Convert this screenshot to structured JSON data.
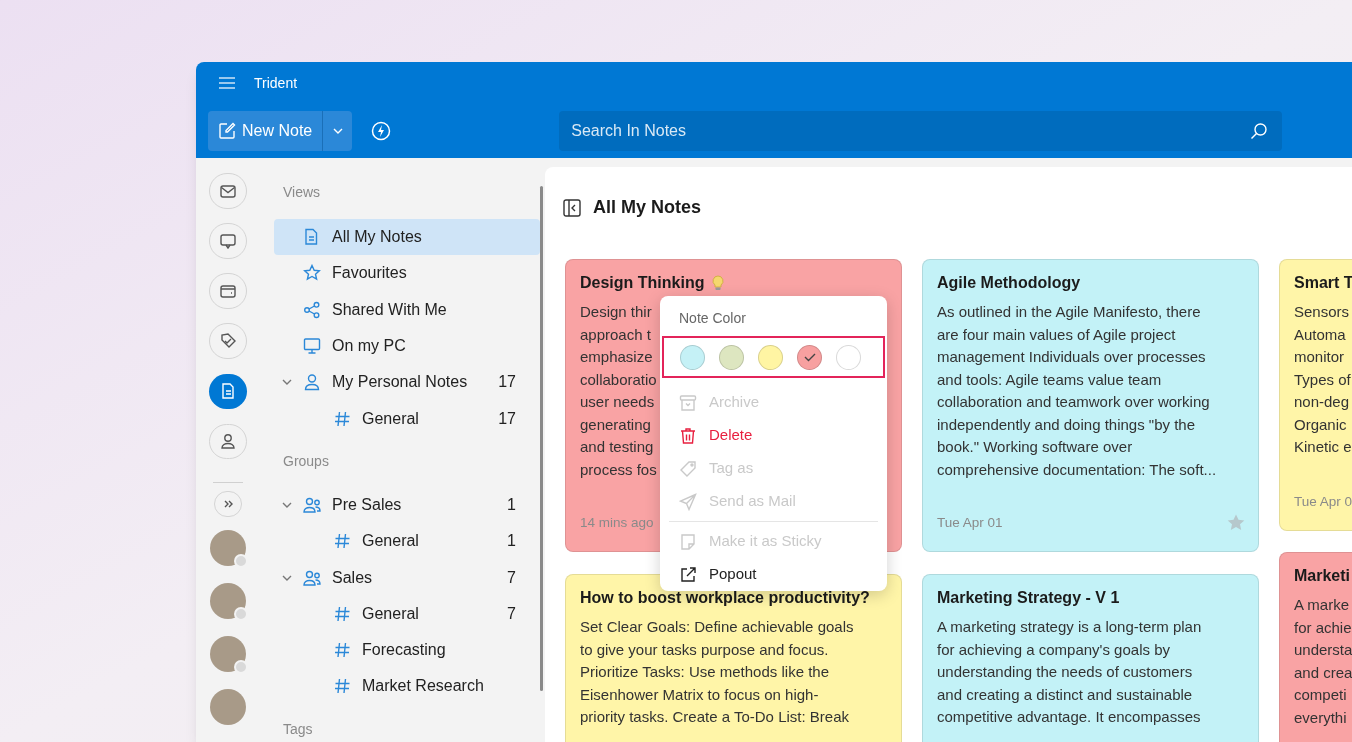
{
  "app": {
    "title": "Trident"
  },
  "toolbar": {
    "new_note": "New Note",
    "search": {
      "placeholder": "Search In Notes"
    }
  },
  "rail": {
    "items": [
      {
        "kind": "mail",
        "selected": false
      },
      {
        "kind": "chat",
        "selected": false
      },
      {
        "kind": "wallet",
        "selected": false
      },
      {
        "kind": "tags",
        "selected": false
      },
      {
        "kind": "notes",
        "selected": true
      },
      {
        "kind": "person",
        "selected": false
      }
    ]
  },
  "nav": {
    "sections": [
      {
        "title": "Views",
        "items": [
          {
            "label": "All My Notes",
            "kind": "note",
            "selected": true
          },
          {
            "label": "Favourites",
            "kind": "star",
            "selected": false
          },
          {
            "label": "Shared With Me",
            "kind": "share",
            "selected": false
          },
          {
            "label": "On my PC",
            "kind": "monitor",
            "selected": false
          },
          {
            "label": "My Personal Notes",
            "kind": "person",
            "count": "17",
            "expanded": true,
            "selected": false,
            "children": [
              {
                "label": "General",
                "kind": "hash",
                "count": "17",
                "selected": false
              }
            ]
          }
        ]
      },
      {
        "title": "Groups",
        "items": [
          {
            "label": "Pre Sales",
            "kind": "group",
            "count": "1",
            "expanded": true,
            "selected": false,
            "children": [
              {
                "label": "General",
                "kind": "hash",
                "count": "1",
                "selected": false
              }
            ]
          },
          {
            "label": "Sales",
            "kind": "group",
            "count": "7",
            "expanded": true,
            "selected": false,
            "children": [
              {
                "label": "General",
                "kind": "hash",
                "count": "7",
                "selected": false
              },
              {
                "label": "Forecasting",
                "kind": "hash",
                "selected": false
              },
              {
                "label": "Market Research",
                "kind": "hash",
                "selected": false
              }
            ]
          }
        ]
      },
      {
        "title": "Tags"
      }
    ]
  },
  "main": {
    "title": "All My Notes",
    "columns": [
      [
        {
          "title": "Design Thinking",
          "idea_icon": true,
          "color": "#f9a3a4",
          "body": "Design thir\napproach t\nemphasize\ncollaboratio\nuser needs\ngenerating\nand testing\nprocess fos",
          "date": "14 mins ago"
        },
        {
          "title": "How to boost workplace productivity?",
          "color": "#fff5a8",
          "body": "Set Clear Goals: Define achievable goals\nto give your tasks purpose and focus.\nPrioritize Tasks: Use methods like the\nEisenhower Matrix to focus on high-\npriority tasks. Create a To-Do List: Break"
        }
      ],
      [
        {
          "title": "Agile Methodology",
          "color": "#c3f2f7",
          "body": "As outlined in the Agile Manifesto, there\nare four main values of Agile project\nmanagement Individuals over processes\nand tools: Agile teams value team\ncollaboration and teamwork over working\nindependently and doing things \"by the\nbook.\" Working software over\ncomprehensive documentation: The soft...",
          "date": "Tue Apr 01",
          "favourite": false
        },
        {
          "title": "Marketing Strategy - V 1",
          "color": "#c3f2f7",
          "body": "A marketing strategy is a long-term plan\nfor achieving a company's goals by\nunderstanding the needs of customers\nand creating a distinct and sustainable\ncompetitive advantage. It encompasses"
        }
      ],
      [
        {
          "title": "Smart T",
          "color": "#fff5a8",
          "body": "Sensors\nAutoma\nmonitor\nTypes of\nnon-deg\nOrganic\nKinetic e",
          "date": "Tue Apr 0"
        },
        {
          "title": "Marketi",
          "color": "#f9a3a4",
          "body": "A marke\nfor achie\nundersta\nand crea\ncompeti\neverythi"
        }
      ]
    ]
  },
  "context_menu": {
    "title": "Note Color",
    "colors": [
      {
        "color": "#c5f1f6",
        "selected": false
      },
      {
        "color": "#dde6c0",
        "selected": false
      },
      {
        "color": "#fff5a3",
        "selected": false
      },
      {
        "color": "#f7a0a0",
        "selected": true
      },
      {
        "color": "#ffffff",
        "selected": false
      }
    ],
    "groups": [
      [
        {
          "label": "Archive",
          "kind": "archive",
          "disabled": true
        },
        {
          "label": "Delete",
          "kind": "delete",
          "disabled": false,
          "destructive": true
        },
        {
          "label": "Tag as",
          "kind": "tag",
          "disabled": true
        },
        {
          "label": "Send as Mail",
          "kind": "send",
          "disabled": true
        }
      ],
      [
        {
          "label": "Make it as Sticky",
          "kind": "sticky",
          "disabled": true
        },
        {
          "label": "Popout",
          "kind": "popout",
          "disabled": false
        }
      ]
    ]
  }
}
